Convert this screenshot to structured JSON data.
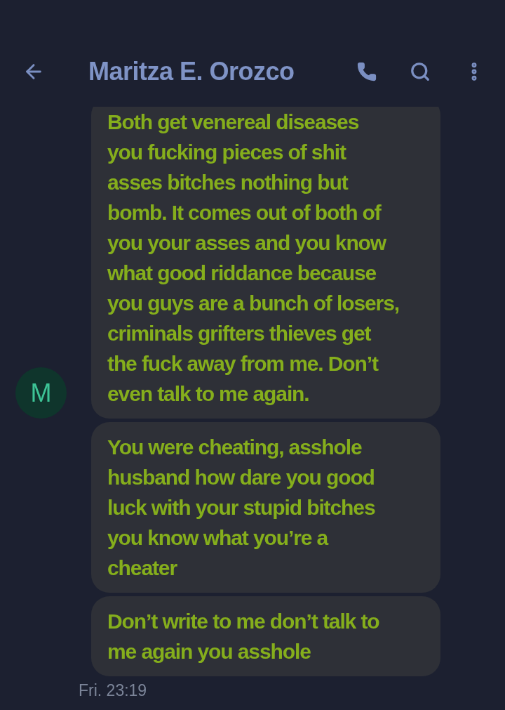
{
  "header": {
    "title": "Maritza E. Orozco"
  },
  "contact": {
    "initial": "M"
  },
  "messages": [
    {
      "avatar": true,
      "lines": [
        "Both get venereal diseases",
        "you fucking pieces of shit",
        "asses bitches nothing but",
        "bomb. It comes out of both of",
        "you your asses and you know",
        "what good riddance because",
        "you guys are a bunch of losers,",
        "criminals grifters thieves get",
        "the fuck away from me. Don’t",
        "even talk to me again."
      ]
    },
    {
      "avatar": false,
      "lines": [
        "You were cheating, asshole",
        "husband how dare you good",
        "luck with your stupid bitches",
        "you know what you’re a",
        "cheater"
      ]
    },
    {
      "avatar": false,
      "lines": [
        "Don’t write to me don’t talk to",
        "me again you asshole"
      ]
    }
  ],
  "timestamp": "Fri. 23:19"
}
